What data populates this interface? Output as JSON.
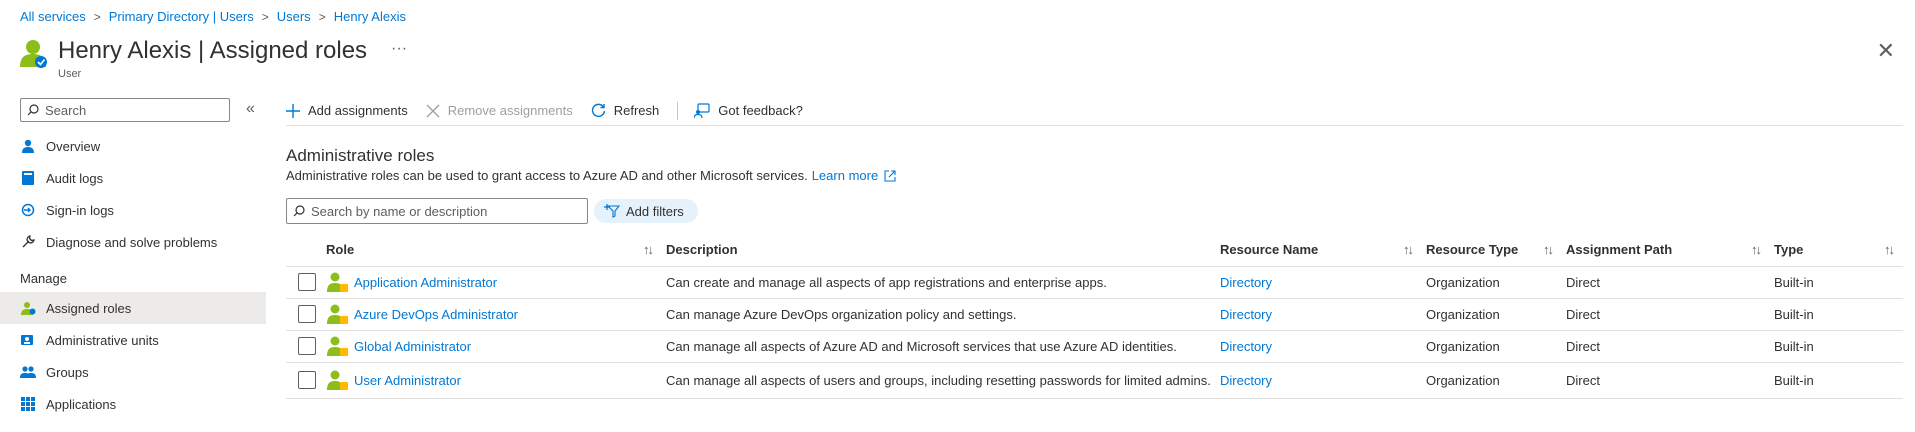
{
  "breadcrumb": [
    "All services",
    "Primary Directory | Users",
    "Users",
    "Henry Alexis"
  ],
  "header": {
    "title": "Henry Alexis | Assigned roles",
    "subtitle": "User",
    "more": "···",
    "close": "✕"
  },
  "sidebar": {
    "search_placeholder": "Search",
    "collapse": "«",
    "items_top": [
      {
        "label": "Overview",
        "icon": "person-icon"
      },
      {
        "label": "Audit logs",
        "icon": "book-icon"
      },
      {
        "label": "Sign-in logs",
        "icon": "sign-in-icon"
      },
      {
        "label": "Diagnose and solve problems",
        "icon": "wrench-icon"
      }
    ],
    "section_manage": "Manage",
    "items_manage": [
      {
        "label": "Assigned roles",
        "icon": "person-role-icon",
        "active": true
      },
      {
        "label": "Administrative units",
        "icon": "admin-units-icon"
      },
      {
        "label": "Groups",
        "icon": "groups-icon"
      },
      {
        "label": "Applications",
        "icon": "apps-grid-icon"
      }
    ]
  },
  "toolbar": {
    "add": "Add assignments",
    "remove": "Remove assignments",
    "refresh": "Refresh",
    "feedback": "Got feedback?"
  },
  "section": {
    "title": "Administrative roles",
    "description": "Administrative roles can be used to grant access to Azure AD and other Microsoft services.",
    "learn_more": "Learn more"
  },
  "filters": {
    "search_placeholder": "Search by name or description",
    "add_filters": "Add filters"
  },
  "table": {
    "columns": [
      "Role",
      "Description",
      "Resource Name",
      "Resource Type",
      "Assignment Path",
      "Type"
    ],
    "sort_glyph": "↑↓",
    "rows": [
      {
        "role": "Application Administrator",
        "description": "Can create and manage all aspects of app registrations and enterprise apps.",
        "resource_name": "Directory",
        "resource_type": "Organization",
        "path": "Direct",
        "type": "Built-in"
      },
      {
        "role": "Azure DevOps Administrator",
        "description": "Can manage Azure DevOps organization policy and settings.",
        "resource_name": "Directory",
        "resource_type": "Organization",
        "path": "Direct",
        "type": "Built-in"
      },
      {
        "role": "Global Administrator",
        "description": "Can manage all aspects of Azure AD and Microsoft services that use Azure AD identities.",
        "resource_name": "Directory",
        "resource_type": "Organization",
        "path": "Direct",
        "type": "Built-in"
      },
      {
        "role": "User Administrator",
        "description": "Can manage all aspects of users and groups, including resetting passwords for limited admins.",
        "resource_name": "Directory",
        "resource_type": "Organization",
        "path": "Direct",
        "type": "Built-in"
      }
    ]
  },
  "colors": {
    "accent": "#0078d4",
    "icon_green": "#8cbd18",
    "active_bg": "#edebe9"
  }
}
